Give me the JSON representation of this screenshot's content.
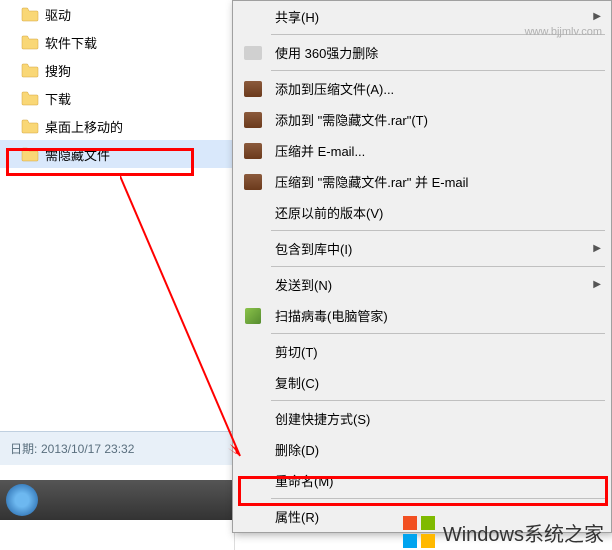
{
  "folders": [
    {
      "label": "驱动"
    },
    {
      "label": "软件下载"
    },
    {
      "label": "搜狗"
    },
    {
      "label": "下载"
    },
    {
      "label": "桌面上移动的"
    },
    {
      "label": "需隐藏文件"
    }
  ],
  "info": {
    "date_label": "日期:",
    "date_value": "2013/10/17 23:32"
  },
  "menu": [
    {
      "label": "共享(H)",
      "icon": "",
      "arrow": true
    },
    {
      "divider": true
    },
    {
      "label": "使用 360强力删除",
      "icon": "printer"
    },
    {
      "divider": true
    },
    {
      "label": "添加到压缩文件(A)...",
      "icon": "rar"
    },
    {
      "label": "添加到 \"需隐藏文件.rar\"(T)",
      "icon": "rar"
    },
    {
      "label": "压缩并 E-mail...",
      "icon": "rar"
    },
    {
      "label": "压缩到 \"需隐藏文件.rar\" 并 E-mail",
      "icon": "rar"
    },
    {
      "label": "还原以前的版本(V)",
      "icon": ""
    },
    {
      "divider": true
    },
    {
      "label": "包含到库中(I)",
      "icon": "",
      "arrow": true
    },
    {
      "divider": true
    },
    {
      "label": "发送到(N)",
      "icon": "",
      "arrow": true
    },
    {
      "label": "扫描病毒(电脑管家)",
      "icon": "shield"
    },
    {
      "divider": true
    },
    {
      "label": "剪切(T)",
      "icon": ""
    },
    {
      "label": "复制(C)",
      "icon": ""
    },
    {
      "divider": true
    },
    {
      "label": "创建快捷方式(S)",
      "icon": ""
    },
    {
      "label": "删除(D)",
      "icon": ""
    },
    {
      "label": "重命名(M)",
      "icon": ""
    },
    {
      "divider": true
    },
    {
      "label": "属性(R)",
      "icon": ""
    }
  ],
  "watermark": {
    "text": "Windows系统之家",
    "url": "www.bjjmlv.com"
  }
}
